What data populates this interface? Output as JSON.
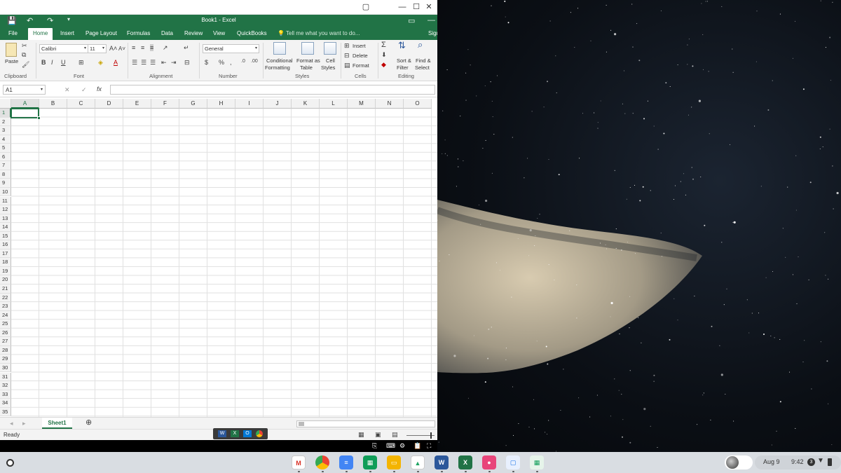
{
  "window": {
    "title": "Book1 - Excel",
    "undo_icon": "undo-icon",
    "redo_icon": "redo-icon",
    "save_icon": "save-icon",
    "ribbon_display_icon": "ribbon-display-icon"
  },
  "tabs": [
    "File",
    "Home",
    "Insert",
    "Page Layout",
    "Formulas",
    "Data",
    "Review",
    "View",
    "QuickBooks"
  ],
  "tell_me": "Tell me what you want to do...",
  "sign_in": "Sign",
  "ribbon": {
    "paste_label": "Paste",
    "clipboard_group": "Clipboard",
    "font_name": "Calibri",
    "font_size": "11",
    "grow_font": "A",
    "shrink_font": "A",
    "bold": "B",
    "italic": "I",
    "underline": "U",
    "font_color": "A",
    "font_group": "Font",
    "alignment_group": "Alignment",
    "number_format": "General",
    "currency": "$",
    "percent": "%",
    "comma": ",",
    "number_group": "Number",
    "cond_fmt_1": "Conditional",
    "cond_fmt_2": "Formatting",
    "fmt_table_1": "Format as",
    "fmt_table_2": "Table",
    "cell_styles_1": "Cell",
    "cell_styles_2": "Styles",
    "styles_group": "Styles",
    "insert": "Insert",
    "delete": "Delete",
    "format": "Format",
    "cells_group": "Cells",
    "sort_1": "Sort &",
    "sort_2": "Filter",
    "find_1": "Find &",
    "find_2": "Select",
    "editing_group": "Editing",
    "autosum": "Σ"
  },
  "formula_bar": {
    "name_box": "A1",
    "cancel": "✕",
    "enter": "✓",
    "fx": "fx",
    "value": ""
  },
  "columns": [
    "A",
    "B",
    "C",
    "D",
    "E",
    "F",
    "G",
    "H",
    "I",
    "J",
    "K",
    "L",
    "M",
    "N",
    "O"
  ],
  "rows": [
    "1",
    "2",
    "3",
    "4",
    "5",
    "6",
    "7",
    "8",
    "9",
    "10",
    "11",
    "12",
    "13",
    "14",
    "15",
    "16",
    "17",
    "18",
    "19",
    "20",
    "21",
    "22",
    "23",
    "24",
    "25",
    "26",
    "27",
    "28",
    "29",
    "30",
    "31",
    "32",
    "33",
    "34",
    "35"
  ],
  "sheet_tab": "Sheet1",
  "add_sheet": "⊕",
  "status": "Ready",
  "taskbar": {
    "date": "Aug 9",
    "time": "9:42",
    "notification_count": "3"
  },
  "shelf_apps": [
    {
      "name": "gmail",
      "label": "M",
      "color": "#ffffff",
      "text": "#d93025"
    },
    {
      "name": "chrome",
      "label": "",
      "color": "#4285f4",
      "text": "#fff"
    },
    {
      "name": "docs",
      "label": "≡",
      "color": "#4285f4",
      "text": "#fff"
    },
    {
      "name": "sheets",
      "label": "▦",
      "color": "#0f9d58",
      "text": "#fff"
    },
    {
      "name": "slides",
      "label": "▭",
      "color": "#f4b400",
      "text": "#fff"
    },
    {
      "name": "drive",
      "label": "▲",
      "color": "#ffffff",
      "text": "#1fa463"
    },
    {
      "name": "word",
      "label": "W",
      "color": "#2b579a",
      "text": "#fff"
    },
    {
      "name": "excel",
      "label": "X",
      "color": "#217346",
      "text": "#fff"
    },
    {
      "name": "screen-recorder",
      "label": "●",
      "color": "#e8457a",
      "text": "#fff"
    },
    {
      "name": "files",
      "label": "▢",
      "color": "#e8f0fe",
      "text": "#1a73e8"
    },
    {
      "name": "sheets-2",
      "label": "▦",
      "color": "#e6f4ea",
      "text": "#0f9d58"
    }
  ],
  "colors": {
    "excel_green": "#217346",
    "selection": "#217346",
    "ribbon_bg": "#f3f3f3",
    "shelf_bg": "#d9dde2"
  }
}
